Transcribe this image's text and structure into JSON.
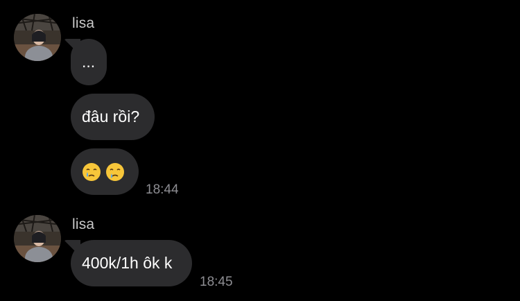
{
  "theme": {
    "background": "#000000",
    "bubble": "#2c2c2e",
    "sender_color": "#c9c9c9",
    "time_color": "#8e8e93",
    "emoji_yellow": "#f7c63a",
    "tear_blue": "#55a7f0"
  },
  "groups": [
    {
      "sender": "lisa",
      "messages": [
        {
          "text": "..."
        },
        {
          "text": "đâu rồi?"
        },
        {
          "emojis": [
            "face-holding-back-tears-icon",
            "face-holding-back-tears-icon"
          ]
        }
      ],
      "time": "18:44"
    },
    {
      "sender": "lisa",
      "messages": [
        {
          "text": "400k/1h ôk k"
        }
      ],
      "time": "18:45"
    }
  ]
}
